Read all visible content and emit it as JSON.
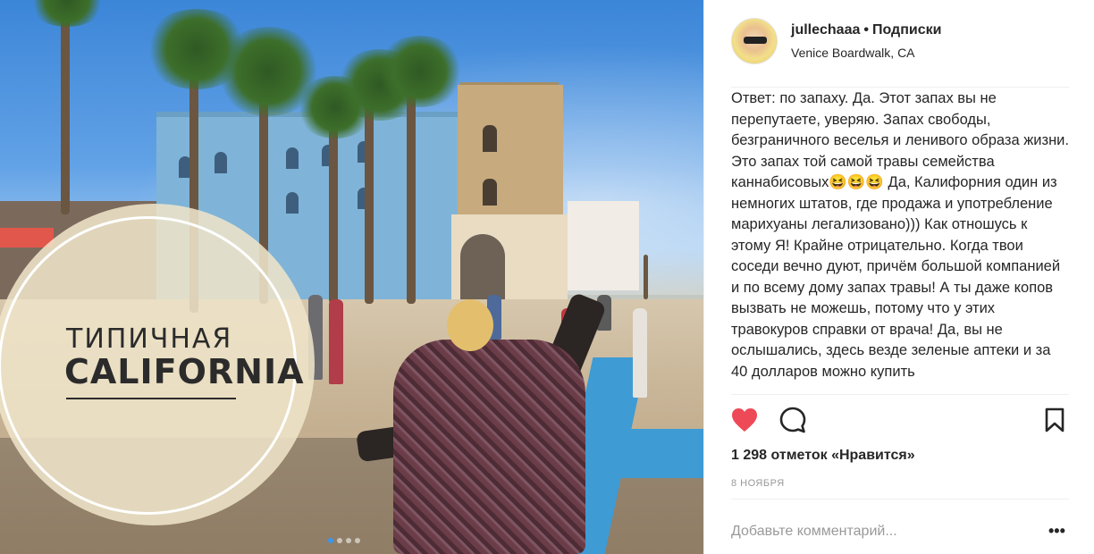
{
  "photo": {
    "overlay_line1": "ТИПИЧНАЯ",
    "overlay_line2": "CALIFORNIA",
    "carousel_dots": 4,
    "carousel_active_index": 0
  },
  "header": {
    "username": "jullechaaa",
    "separator": "•",
    "follow_label": "Подписки",
    "location": "Venice Boardwalk, CA"
  },
  "caption": {
    "text": "Ответ: по запаху. Да. Этот запах вы не перепутаете, уверяю. Запах свободы, безграничного веселья и ленивого образа жизни. Это запах той самой травы семейства каннабисовых😆😆😆 Да, Калифорния один из немногих штатов, где продажа и употребление марихуаны легализовано))) Как отношусь к этому Я! Крайне отрицательно. Когда твои соседи вечно дуют, причём большой компанией и по всему дому запах травы! А ты даже копов вызвать не можешь, потому что у этих травокуров справки от врача! Да, вы не ослышались, здесь везде зеленые аптеки и за 40 долларов можно купить"
  },
  "actions": {
    "like_icon": "heart-filled-icon",
    "comment_icon": "speech-bubble-icon",
    "save_icon": "bookmark-icon",
    "like_color": "#ed4956"
  },
  "likes_text": "1 298 отметок «Нравится»",
  "date_text": "8 НОЯБРЯ",
  "comment_placeholder": "Добавьте комментарий...",
  "more_label": "•••"
}
